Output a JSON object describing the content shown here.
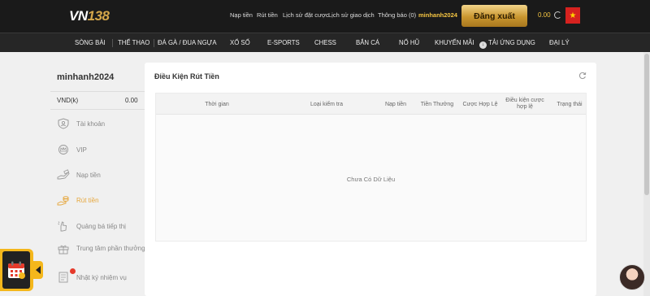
{
  "header": {
    "logo_main": "VN",
    "logo_num": "138",
    "links": [
      "Nạp tiền",
      "Rút tiền",
      "Lịch sử đặt cược",
      "Lịch sử giao dịch",
      "Thông báo (0)"
    ],
    "username": "minhanh2024",
    "logout_label": "Đăng xuất",
    "balance": "0.00",
    "flag_icon": "vietnam-flag-icon"
  },
  "nav": {
    "items": [
      "SÒNG BÀI",
      "THỂ THAO",
      "ĐÁ GÀ / ĐUA NGỰA",
      "XỔ SỐ",
      "E-SPORTS",
      "CHESS",
      "BẮN CÁ",
      "NỔ HŨ",
      "KHUYẾN MÃI",
      "TẢI ỨNG DỤNG",
      "ĐẠI LÝ"
    ]
  },
  "sidebar": {
    "username": "minhanh2024",
    "currency": "VND(k)",
    "amount": "0.00",
    "items": [
      {
        "label": "Tài khoản",
        "icon": "shield-user-icon",
        "active": false
      },
      {
        "label": "VIP",
        "icon": "crown-icon",
        "active": false
      },
      {
        "label": "Nạp tiền",
        "icon": "deposit-hand-icon",
        "active": false
      },
      {
        "label": "Rút tiền",
        "icon": "withdraw-coins-icon",
        "active": true
      },
      {
        "label": "Quảng bá tiếp thị",
        "icon": "referral-hand-icon",
        "active": false
      },
      {
        "label": "Trung tâm phần thưởng",
        "icon": "gift-icon",
        "active": false
      },
      {
        "label": "Nhật ký nhiệm vụ",
        "icon": "task-log-icon",
        "active": false
      }
    ]
  },
  "main": {
    "title": "Điều Kiện Rút Tiền",
    "columns": [
      "Thời gian",
      "Loại kiểm tra",
      "Nạp tiền",
      "Tiền Thưởng",
      "Cược Hợp Lệ",
      "Điều kiện cược hợp lệ",
      "Trạng thái"
    ],
    "empty_text": "Chưa Có Dữ Liệu"
  },
  "colors": {
    "accent_gold": "#e6a73c",
    "header_bg": "#1a1a1a",
    "nav_bg": "#262626"
  }
}
